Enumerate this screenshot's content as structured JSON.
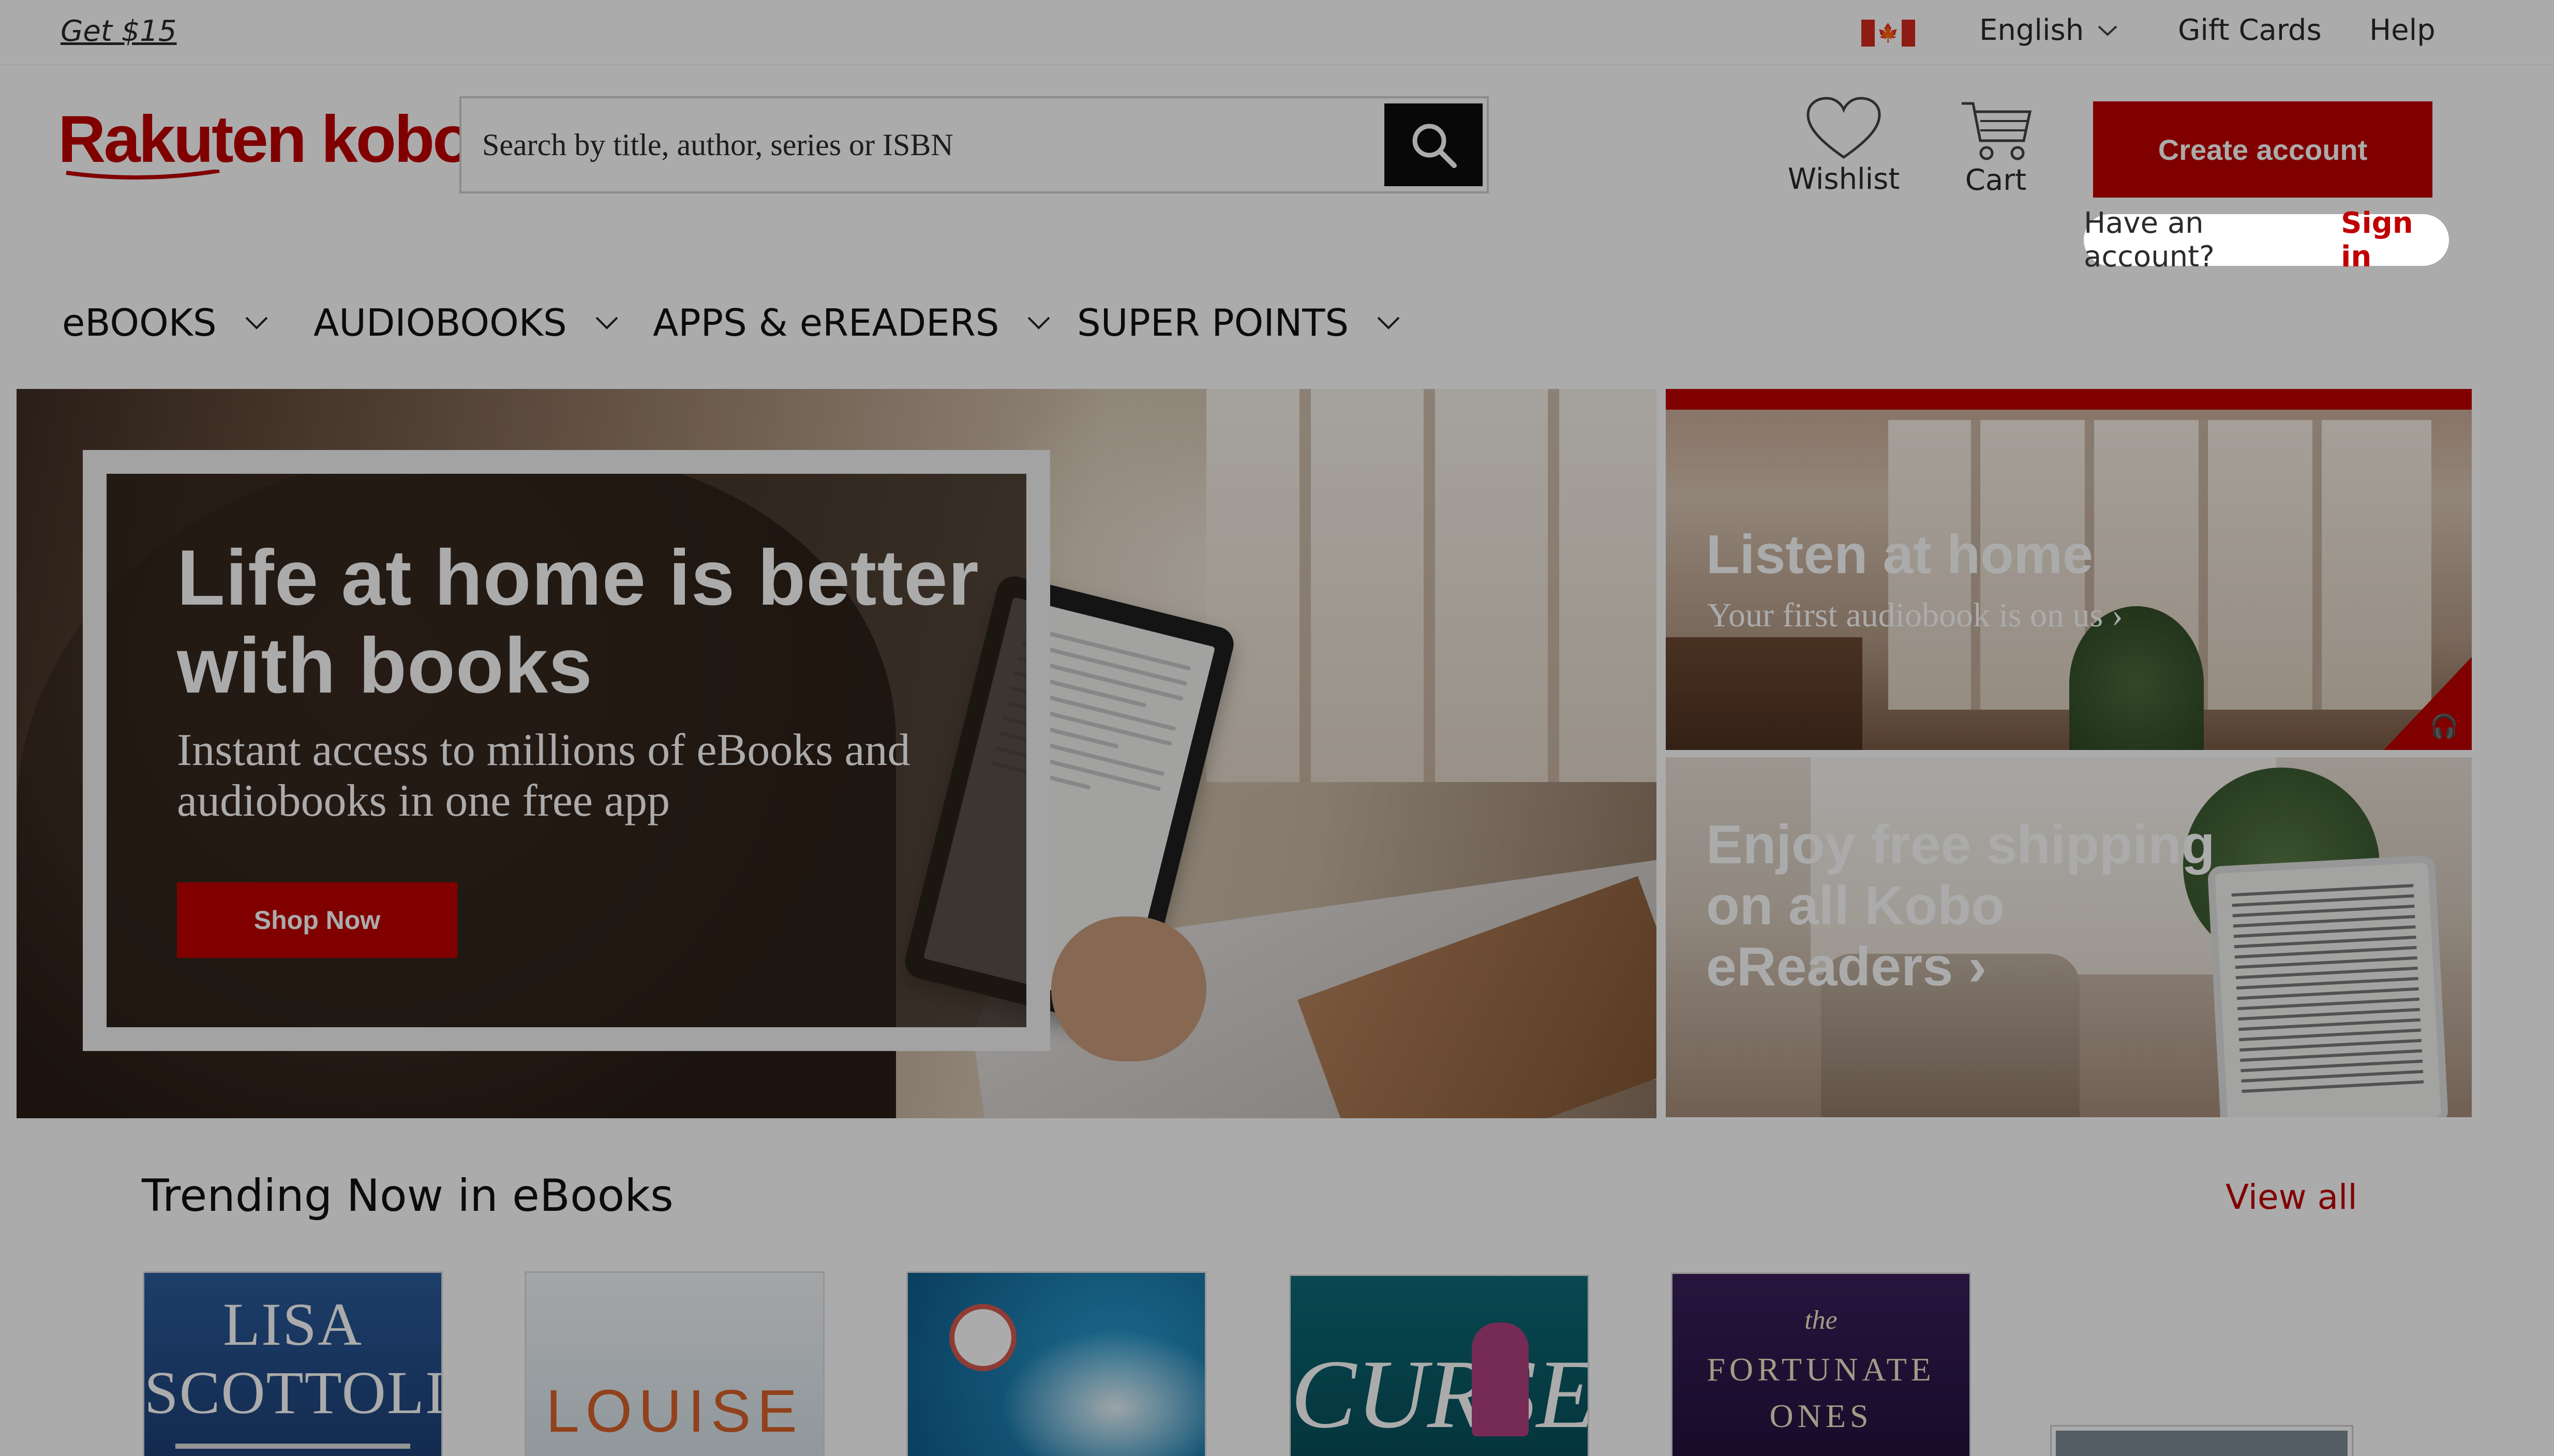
{
  "topbar": {
    "promo_link": "Get $15",
    "flag_icon": "canada-flag-icon",
    "language": "English",
    "gift_cards": "Gift Cards",
    "help": "Help"
  },
  "header": {
    "logo_text": "Rakuten kobo",
    "search_placeholder": "Search by title, author, series or ISBN",
    "wishlist": "Wishlist",
    "cart": "Cart",
    "create_account": "Create account",
    "have_account": "Have an account?",
    "sign_in": "Sign in"
  },
  "nav": {
    "items": [
      {
        "label": "eBOOKS"
      },
      {
        "label": "AUDIOBOOKS"
      },
      {
        "label": "APPS & eREADERS"
      },
      {
        "label": "SUPER POINTS"
      }
    ]
  },
  "hero": {
    "title": "Life at home is better with books",
    "subtitle": "Instant access to millions of eBooks and audiobooks in one free app",
    "button": "Shop Now"
  },
  "promos": [
    {
      "title": "Listen at home",
      "subtitle": "Your first audiobook is on us ›"
    },
    {
      "title": "Enjoy free shipping on all Kobo eReaders ›"
    }
  ],
  "trending": {
    "title": "Trending Now in eBooks",
    "view_all": "View all",
    "books": [
      {
        "cover_text": "LISA SCOTTOLINE"
      },
      {
        "cover_text": "LOUISE"
      },
      {
        "cover_text": ""
      },
      {
        "cover_text": "CURSES"
      },
      {
        "cover_top": "the",
        "cover_text": "FORTUNATE ONES"
      }
    ]
  },
  "colors": {
    "brand_red": "#bf0000",
    "overlay": "rgba(0,0,0,0.33)"
  }
}
